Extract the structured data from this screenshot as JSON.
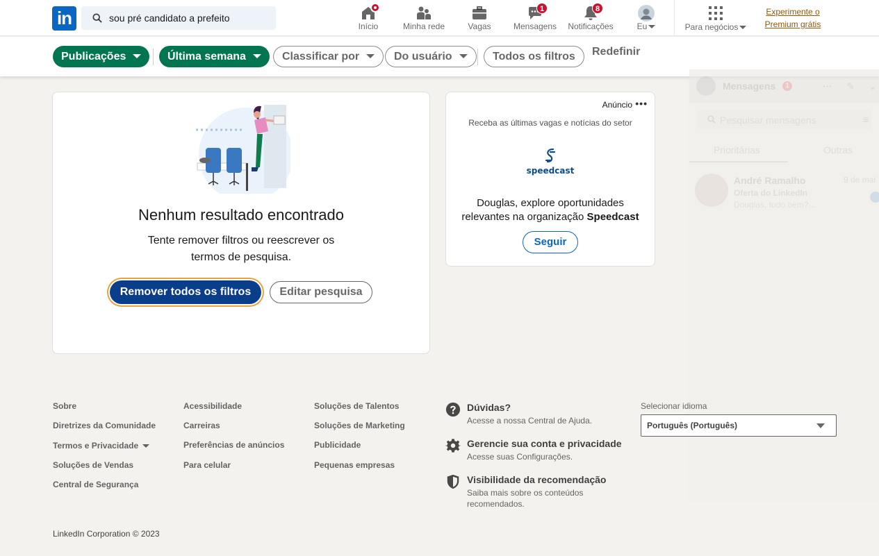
{
  "nav": {
    "logo_text": "in",
    "search_value": "sou pré candidato a prefeito",
    "items": [
      {
        "label": "Início",
        "icon": "home-icon",
        "badge": ""
      },
      {
        "label": "Minha rede",
        "icon": "network-icon",
        "badge": ""
      },
      {
        "label": "Vagas",
        "icon": "briefcase-icon",
        "badge": ""
      },
      {
        "label": "Mensagens",
        "icon": "messaging-icon",
        "badge": "1"
      },
      {
        "label": "Notificações",
        "icon": "bell-icon",
        "badge": "8"
      },
      {
        "label": "Eu",
        "icon": "avatar-icon",
        "badge": ""
      }
    ],
    "business_label": "Para negócios",
    "premium_line1": "Experimente o",
    "premium_line2": "Premium grátis"
  },
  "filters": {
    "pills": [
      {
        "label": "Publicações",
        "active": true
      },
      {
        "label": "Última semana",
        "active": true
      },
      {
        "label": "Classificar por",
        "active": false
      },
      {
        "label": "Do usuário",
        "active": false
      },
      {
        "label": "Todos os filtros",
        "active": false
      }
    ],
    "reset_label": "Redefinir"
  },
  "empty_state": {
    "title": "Nenhum resultado encontrado",
    "subtitle": "Tente remover filtros ou reescrever os termos de pesquisa.",
    "primary_button": "Remover todos os filtros",
    "secondary_button": "Editar pesquisa"
  },
  "ad": {
    "label": "Anúncio",
    "tagline": "Receba as últimas vagas e notícias do setor",
    "company_logo_text": "speedcast",
    "text_prefix": "Douglas, explore oportunidades relevantes na organização",
    "company": "Speedcast",
    "follow_button": "Seguir"
  },
  "messaging": {
    "title": "Mensagens",
    "badge": "1",
    "search_placeholder": "Pesquisar mensagens",
    "tabs": [
      "Prioritárias",
      "Outras"
    ],
    "conversation": {
      "name": "André Ramalho",
      "date": "9 de mai",
      "line1": "Oferta do LinkedIn",
      "line2": "Douglas, tudo bem?..."
    }
  },
  "footer": {
    "col1": [
      "Sobre",
      "Diretrizes da Comunidade",
      "Termos e Privacidade",
      "Soluções de Vendas",
      "Central de Segurança"
    ],
    "col2": [
      "Acessibilidade",
      "Carreiras",
      "Preferências de anúncios",
      "Para celular"
    ],
    "col3": [
      "Soluções de Talentos",
      "Soluções de Marketing",
      "Publicidade",
      "Pequenas empresas"
    ],
    "help": [
      {
        "title": "Dúvidas?",
        "desc": "Acesse a nossa Central de Ajuda.",
        "icon": "question-icon"
      },
      {
        "title": "Gerencie sua conta e privacidade",
        "desc": "Acesse suas Configurações.",
        "icon": "gear-icon"
      },
      {
        "title": "Visibilidade da recomendação",
        "desc": "Saiba mais sobre os conteúdos recomendados.",
        "icon": "shield-icon"
      }
    ],
    "language_label": "Selecionar idioma",
    "language_value": "Português (Português)",
    "copyright": "LinkedIn Corporation © 2023"
  },
  "colors": {
    "brand": "#0a66c2",
    "active_filter": "#01754f",
    "primary_button": "#0a3d8a",
    "premium": "#915907",
    "badge": "#cb112d"
  }
}
